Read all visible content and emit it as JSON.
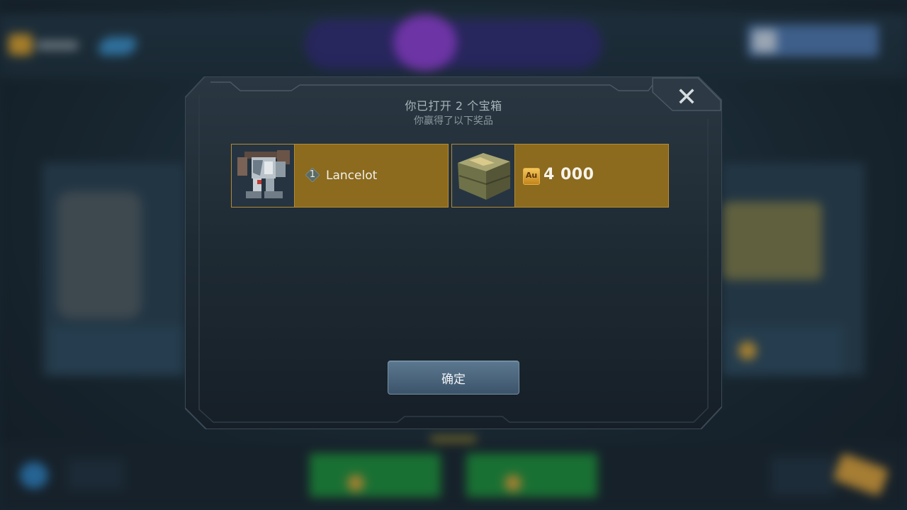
{
  "dialog": {
    "title": "你已打开 2 个宝箱",
    "subtitle": "你赢得了以下奖品",
    "close_glyph": "✕",
    "confirm_label": "确定"
  },
  "rewards": [
    {
      "type": "robot",
      "icon": "robot-icon",
      "rank": "1",
      "name": "Lancelot"
    },
    {
      "type": "gold",
      "icon": "gold-crate-icon",
      "currency_label": "Au",
      "amount": "4 000"
    }
  ],
  "colors": {
    "reward_bg": "#8c6a1e",
    "confirm_button": "#4a657c",
    "gold_icon": "#e0a635"
  }
}
